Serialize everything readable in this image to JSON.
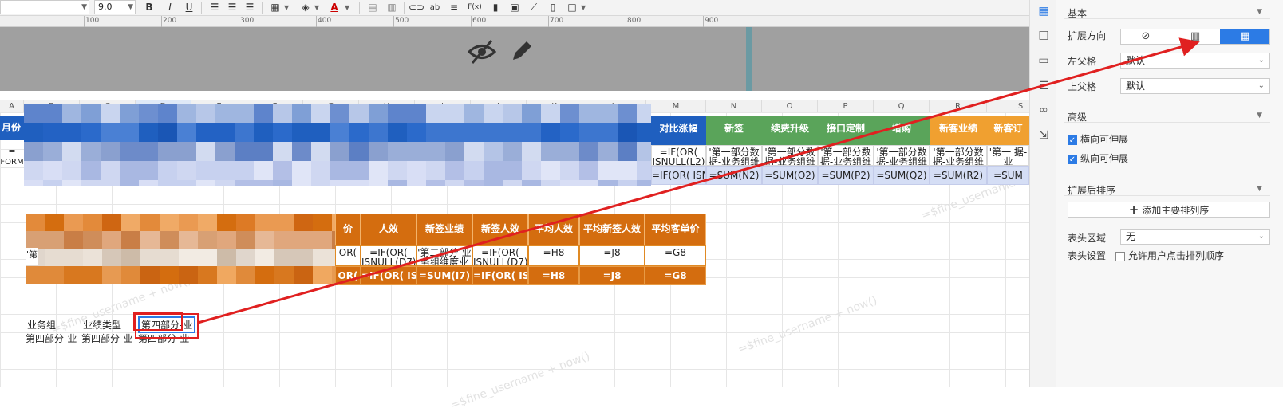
{
  "toolbar": {
    "font_name": "",
    "font_size": "9.0",
    "bold": "B",
    "italic": "I",
    "underline": "U",
    "text_color": "A",
    "ab": "ab",
    "fx": "F(x)"
  },
  "ruler": {
    "labels": [
      "100",
      "200",
      "300",
      "400",
      "500",
      "600",
      "700",
      "800",
      "900"
    ]
  },
  "columns": [
    "A",
    "B",
    "C",
    "D",
    "E",
    "F",
    "G",
    "H",
    "I",
    "J",
    "K",
    "L",
    "M",
    "N",
    "O",
    "P",
    "Q",
    "R",
    "S"
  ],
  "table1": {
    "col_a_header": "月份",
    "col_a_formula1": "=",
    "col_a_formula2": "FORM",
    "visible_headers": [
      {
        "label": "对比涨幅",
        "style": "blue"
      },
      {
        "label": "新签",
        "style": "green"
      },
      {
        "label": "续费升级",
        "style": "green"
      },
      {
        "label": "接口定制",
        "style": "green"
      },
      {
        "label": "增购",
        "style": "green"
      },
      {
        "label": "新客业绩",
        "style": "orange"
      },
      {
        "label": "新客订",
        "style": "orange"
      }
    ],
    "row1": [
      "=IF(OR( ISNULL(L2)",
      "'第一部分数 据-业务组维",
      "'第一部分数 据-业务组维",
      "'第一部分数 据-业务组维",
      "'第一部分数 据-业务组维",
      "'第一部分数 据-业务组维",
      "'第一 据-业"
    ],
    "row2": [
      "=IF(OR( ISNULL(L3)",
      "=SUM(N2)",
      "=SUM(O2)",
      "=SUM(P2)",
      "=SUM(Q2)",
      "=SUM(R2)",
      "=SUM"
    ]
  },
  "table2": {
    "headers": [
      "价",
      "人效",
      "新签业绩",
      "新签人效",
      "平均人效",
      "平均新签人效",
      "平均客单价"
    ],
    "row1_first": "'第",
    "row1": [
      "OR(",
      "=IF(OR( ISNULL(D7)",
      "'第二部分-业 务组维度业",
      "=IF(OR( ISNULL(D7)",
      "=H8",
      "=J8",
      "=G8"
    ],
    "row2": [
      "OR(",
      "=IF(OR( ISNULL(D",
      "=SUM(I7)",
      "=IF(OR( ISNULL(D",
      "=H8",
      "=J8",
      "=G8"
    ]
  },
  "table3": {
    "headers": [
      "业务组",
      "业绩类型",
      "第四部分-业"
    ],
    "values": [
      "第四部分-业",
      "第四部分-业",
      "第四部分-业"
    ]
  },
  "watermark": "=$fine_username + now()",
  "panel": {
    "basic_title": "基本",
    "expand_direction_label": "扩展方向",
    "left_parent_label": "左父格",
    "left_parent_value": "默认",
    "top_parent_label": "上父格",
    "top_parent_value": "默认",
    "advanced_title": "高级",
    "horizontal_expand": "横向可伸展",
    "vertical_expand": "纵向可伸展",
    "sort_after_expand": "扩展后排序",
    "add_sort_button": "添加主要排列序",
    "add_sort_plus": "+",
    "header_area_label": "表头区域",
    "header_area_value": "无",
    "header_setting_label": "表头设置",
    "allow_user_sort": "允许用户点击排列顺序"
  },
  "colors": {
    "accent": "#2c7be5",
    "header_blue": "#1f5fbf",
    "header_green": "#5aa45a",
    "header_orange": "#f0a030",
    "header_dark_orange": "#d46d0f",
    "annotation_red": "#e02020"
  }
}
